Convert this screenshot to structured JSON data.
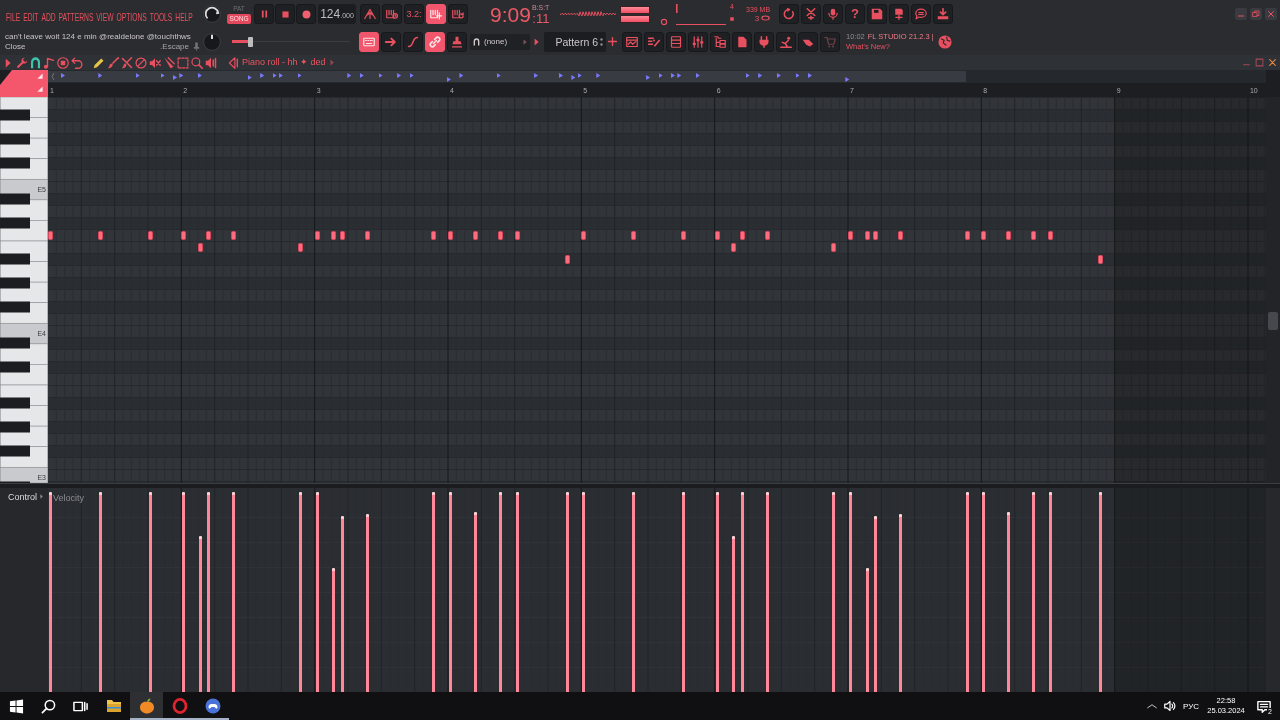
{
  "menu": [
    "FILE",
    "EDIT",
    "ADD",
    "PATTERNS",
    "VIEW",
    "OPTIONS",
    "TOOLS",
    "HELP"
  ],
  "transport": {
    "volume_knob": {
      "level": 0.8
    },
    "modes": [
      {
        "label": "PAT",
        "selected": false
      },
      {
        "label": "SONG",
        "selected": true
      }
    ],
    "tempo": {
      "whole": "124",
      "fraction": ".000"
    }
  },
  "record_options": [
    {
      "on": false
    },
    {
      "on": false
    },
    {
      "label": "3.2:",
      "on": false
    },
    {
      "on": true
    },
    {
      "on": false
    }
  ],
  "clock": {
    "main": "9:09",
    "sub": ":11",
    "format": "B:S:T"
  },
  "output_meter": [
    {
      "level": 1
    },
    {
      "level": 1
    }
  ],
  "monitor": {
    "cpu": "4",
    "memory": "339 MB",
    "polyphony": "3"
  },
  "toolbar": {
    "help_label": "?"
  },
  "hint_bar": {
    "text": "can't leave woit 124 e min @realdelone @touchthws",
    "action": "Close",
    "shortcut": ".Escape"
  },
  "pitch_knob": {
    "level": 0.5
  },
  "slider": {
    "level": 0.15
  },
  "panel_options": [
    {
      "on": true
    },
    {
      "on": false
    },
    {
      "on": false
    },
    {
      "on": true
    },
    {
      "on": false
    }
  ],
  "pattern": {
    "snap": "(none)",
    "name": "Pattern 6"
  },
  "news": {
    "time": "10:02",
    "title": "FL STUDIO 21.2.3 |",
    "link": "What's New?"
  },
  "piano_roll": {
    "snap": {
      "on": true
    },
    "tools": [
      {
        "selected": true
      },
      {
        "selected": false
      },
      {
        "selected": false
      },
      {
        "selected": false
      },
      {
        "selected": false
      },
      {
        "selected": false
      },
      {
        "selected": false
      },
      {
        "selected": false
      },
      {
        "selected": false
      }
    ],
    "title": "Piano roll - hh ✦ ded",
    "bars": [
      "1",
      "2",
      "3",
      "4",
      "5",
      "6",
      "7",
      "8",
      "9",
      "10"
    ],
    "key_labels": [
      "E5",
      "E4",
      "E3"
    ],
    "control": {
      "label": "Control",
      "parameter": "Velocity"
    },
    "notes": [
      {
        "level": 1
      },
      {
        "level": 1
      },
      {
        "level": 1
      },
      {
        "level": 1
      },
      {
        "level": 0.78
      },
      {
        "level": 1
      },
      {
        "level": 1
      },
      {
        "level": 1
      },
      {
        "level": 1
      },
      {
        "level": 0.62
      },
      {
        "level": 0.88
      },
      {
        "level": 0.89
      },
      {
        "level": 1
      },
      {
        "level": 1
      },
      {
        "level": 0.9
      },
      {
        "level": 1
      },
      {
        "level": 1
      },
      {
        "level": 1
      },
      {
        "level": 1
      },
      {
        "level": 1
      },
      {
        "level": 1
      },
      {
        "level": 1
      },
      {
        "level": 0.78
      },
      {
        "level": 1
      },
      {
        "level": 1
      },
      {
        "level": 1
      },
      {
        "level": 1
      },
      {
        "level": 0.62
      },
      {
        "level": 0.88
      },
      {
        "level": 0.89
      },
      {
        "level": 1
      },
      {
        "level": 1
      },
      {
        "level": 0.9
      },
      {
        "level": 1
      },
      {
        "level": 1
      },
      {
        "level": 1
      }
    ]
  },
  "taskbar": {
    "apps": [
      {
        "running": false,
        "selected": false
      },
      {
        "running": true,
        "selected": true
      },
      {
        "running": true,
        "selected": false
      },
      {
        "running": true,
        "selected": false
      }
    ],
    "language": "РУС",
    "time": "22:58",
    "date": "25.03.2024",
    "notifications": "2"
  }
}
